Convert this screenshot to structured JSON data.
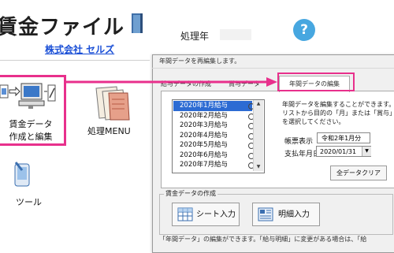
{
  "app": {
    "title": "賃金ファイル",
    "company": "株式会社 セルズ",
    "year_label": "処理年",
    "help": "?"
  },
  "menu": {
    "create_edit": [
      "賃金データ",
      "作成と編集"
    ],
    "process_menu": "処理MENU",
    "tools": "ツール"
  },
  "dialog": {
    "title": "年間データを再編集します。",
    "tabs": [
      "給与データの作成",
      "賞与データ",
      "年間データの編集"
    ],
    "months": [
      {
        "label": "2020年1月給与",
        "selected": true
      },
      {
        "label": "2020年2月給与",
        "selected": false
      },
      {
        "label": "2020年3月給与",
        "selected": false
      },
      {
        "label": "2020年4月給与",
        "selected": false
      },
      {
        "label": "2020年5月給与",
        "selected": false
      },
      {
        "label": "2020年6月給与",
        "selected": false
      },
      {
        "label": "2020年7月給与",
        "selected": false
      }
    ],
    "description": "年間データを編集することができます。リストから目的の「月」または「賞与」を選択してください。",
    "display_label": "帳票表示",
    "display_value": "令和2年1月分",
    "pay_date_label": "支払年月日",
    "pay_date_value": "2020/01/31",
    "clear_button": "全データクリア",
    "group_label": "賃金データの作成",
    "sheet_button": "シート入力",
    "detail_button": "明細入力",
    "bottom_text": "「年間データ」の編集ができます。「給与明細」に変更がある場合は、「給"
  },
  "colors": {
    "highlight": "#e8308c",
    "link": "#1a4fd6",
    "selected": "#2c6bd3",
    "help": "#47a7e0"
  }
}
